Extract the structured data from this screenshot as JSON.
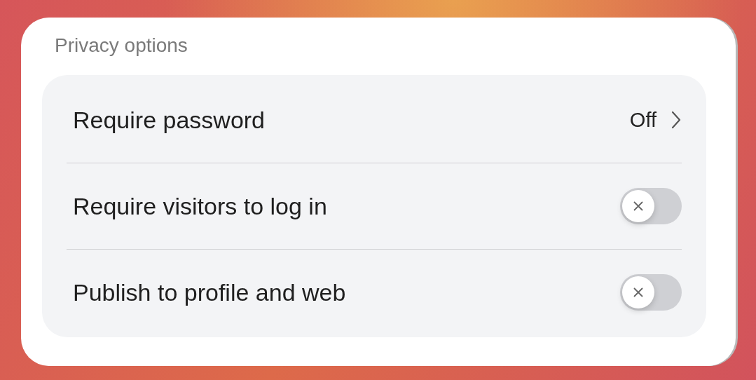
{
  "section_title": "Privacy options",
  "rows": [
    {
      "kind": "link",
      "label": "Require password",
      "value": "Off"
    },
    {
      "kind": "toggle",
      "label": "Require visitors to log in",
      "on": false
    },
    {
      "kind": "toggle",
      "label": "Publish to profile and web",
      "on": false
    }
  ]
}
